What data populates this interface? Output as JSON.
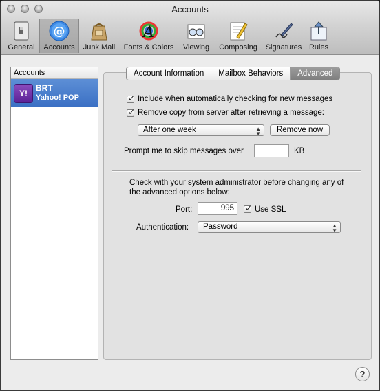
{
  "window": {
    "title": "Accounts"
  },
  "toolbar": {
    "items": [
      {
        "label": "General",
        "icon": "switch-icon",
        "selected": false
      },
      {
        "label": "Accounts",
        "icon": "at-sign-icon",
        "selected": true
      },
      {
        "label": "Junk Mail",
        "icon": "junk-bag-icon",
        "selected": false
      },
      {
        "label": "Fonts & Colors",
        "icon": "font-colors-icon",
        "selected": false
      },
      {
        "label": "Viewing",
        "icon": "glasses-icon",
        "selected": false
      },
      {
        "label": "Composing",
        "icon": "pencil-paper-icon",
        "selected": false
      },
      {
        "label": "Signatures",
        "icon": "signature-pen-icon",
        "selected": false
      },
      {
        "label": "Rules",
        "icon": "rules-icon",
        "selected": false
      }
    ]
  },
  "sidebar": {
    "header": "Accounts",
    "accounts": [
      {
        "name": "BRT",
        "type": "Yahoo! POP",
        "icon_text": "Y!"
      }
    ]
  },
  "tabs": [
    "Account Information",
    "Mailbox Behaviors",
    "Advanced"
  ],
  "advanced": {
    "include_auto_check": {
      "label": "Include when automatically checking for new messages",
      "checked": true
    },
    "remove_copy": {
      "label": "Remove copy from server after retrieving a message:",
      "checked": true
    },
    "remove_after": "After one week",
    "remove_now": "Remove now",
    "skip_prompt_label": "Prompt me to skip messages over",
    "skip_value": "",
    "skip_unit": "KB",
    "admin_note": "Check with your system administrator before changing any of the advanced options below:",
    "port_label": "Port:",
    "port_value": "995",
    "use_ssl": {
      "label": "Use SSL",
      "checked": true
    },
    "auth_label": "Authentication:",
    "auth_value": "Password"
  },
  "help_label": "?"
}
